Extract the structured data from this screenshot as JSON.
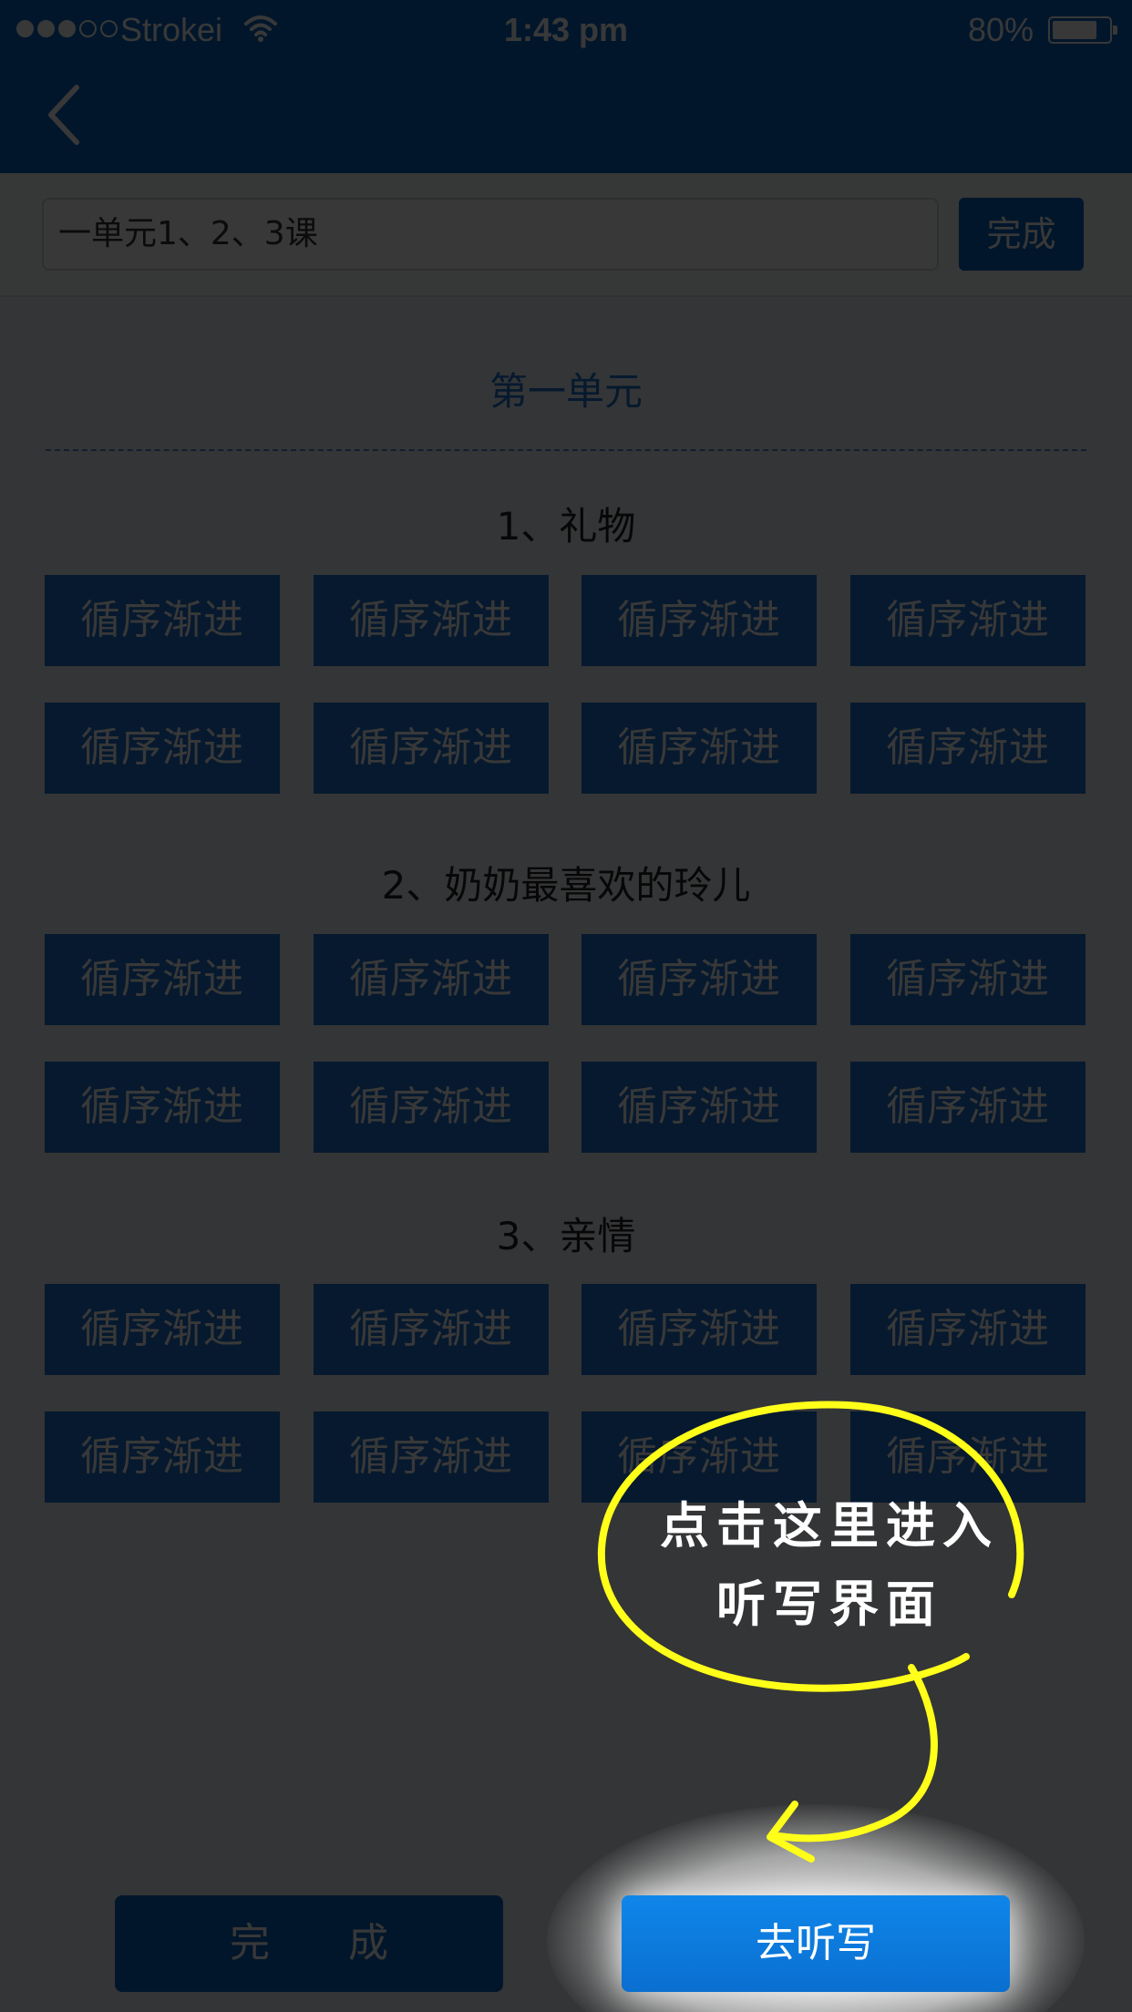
{
  "status_bar": {
    "carrier": "Strokei",
    "time": "1:43 pm",
    "battery_percent": "80%",
    "battery_level": 0.8
  },
  "nav": {
    "back_icon": "chevron-left-icon"
  },
  "search": {
    "value": "一单元1、2、3课",
    "done_label": "完成"
  },
  "unit": {
    "title": "第一单元"
  },
  "lessons": [
    {
      "title": "1、礼物",
      "chips": [
        "循序渐进",
        "循序渐进",
        "循序渐进",
        "循序渐进",
        "循序渐进",
        "循序渐进",
        "循序渐进",
        "循序渐进"
      ]
    },
    {
      "title": "2、奶奶最喜欢的玲儿",
      "chips": [
        "循序渐进",
        "循序渐进",
        "循序渐进",
        "循序渐进",
        "循序渐进",
        "循序渐进",
        "循序渐进",
        "循序渐进"
      ]
    },
    {
      "title": "3、亲情",
      "chips": [
        "循序渐进",
        "循序渐进",
        "循序渐进",
        "循序渐进",
        "循序渐进",
        "循序渐进",
        "循序渐进",
        "循序渐进"
      ]
    }
  ],
  "bottom": {
    "done_label": "完 成",
    "go_label": "去听写"
  },
  "tutorial": {
    "line1": "点击这里进入",
    "line2": "听写界面"
  },
  "colors": {
    "primary": "#0a66c2",
    "chip": "#1e73d2",
    "hint_stroke": "#ffff1a"
  }
}
